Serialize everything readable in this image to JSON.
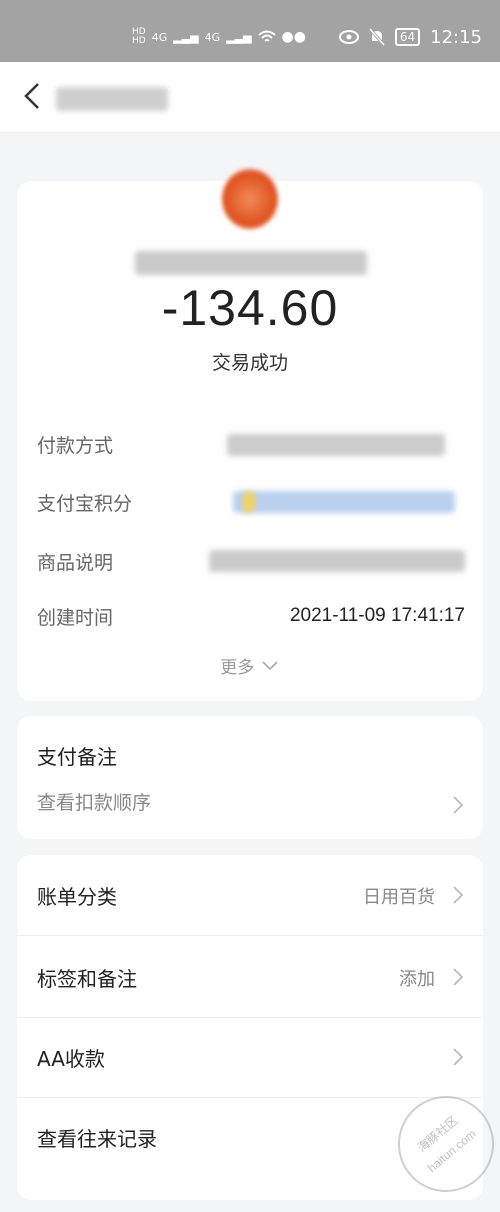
{
  "status_bar": {
    "network_1": "4G",
    "network_2": "4G",
    "battery": "64",
    "time": "12:15"
  },
  "transaction": {
    "amount": "-134.60",
    "status": "交易成功"
  },
  "details": [
    {
      "label": "付款方式",
      "value": ""
    },
    {
      "label": "支付宝积分",
      "value": ""
    },
    {
      "label": "商品说明",
      "value": ""
    },
    {
      "label": "创建时间",
      "value": "2021-11-09 17:41:17"
    }
  ],
  "more_label": "更多",
  "note": {
    "title": "支付备注",
    "link": "查看扣款顺序"
  },
  "actions": [
    {
      "label": "账单分类",
      "value": "日用百货"
    },
    {
      "label": "标签和备注",
      "value": "添加"
    },
    {
      "label": "AA收款",
      "value": ""
    },
    {
      "label": "查看往来记录",
      "value": ""
    }
  ],
  "watermark": {
    "line1": "海豚社区",
    "line2": "haitun.com"
  },
  "icons": [
    "back-arrow-icon",
    "chevron-down-icon",
    "chevron-right-icon",
    "wifi-icon",
    "eye-icon",
    "mute-bell-icon",
    "battery-icon"
  ]
}
